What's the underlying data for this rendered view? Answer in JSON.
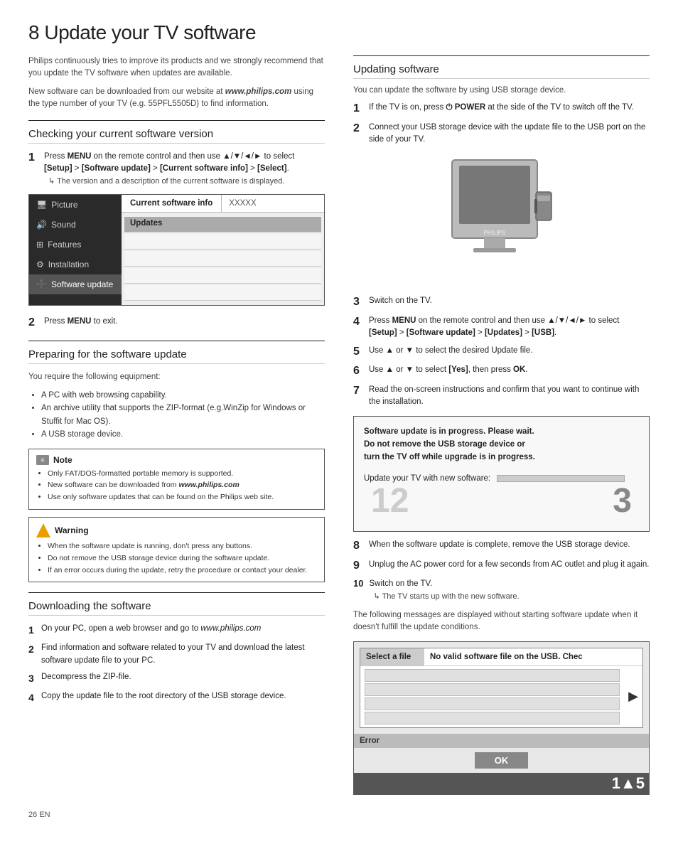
{
  "page": {
    "number": "26",
    "lang": "EN"
  },
  "main_title": "Update your TV software",
  "main_title_num": "8",
  "intro": [
    "Philips continuously tries to improve its products and we strongly recommend that you update the TV software when updates are available.",
    "New software can be downloaded from our website at www.philips.com using the type number of your TV (e.g. 55PFL5505D) to find information."
  ],
  "section_check": {
    "title": "Checking your current software version",
    "steps": [
      {
        "num": "1",
        "text": "Press MENU on the remote control and then use ▲/▼/◄/► to select [Setup] > [Software update] > [Current software info] > [Select].",
        "note": "The version and a description of the current software is displayed."
      },
      {
        "num": "2",
        "text": "Press MENU to exit."
      }
    ],
    "menu": {
      "items": [
        {
          "label": "Picture",
          "icon": "tv"
        },
        {
          "label": "Sound",
          "icon": "speaker"
        },
        {
          "label": "Features",
          "icon": "grid"
        },
        {
          "label": "Installation",
          "icon": "gear"
        },
        {
          "label": "Software update",
          "icon": "plus",
          "active": true
        }
      ],
      "tabs": [
        {
          "label": "Current software info",
          "selected": true
        },
        {
          "label": "XXXXX"
        }
      ],
      "rows": [
        {
          "label": "Updates",
          "highlight": true
        },
        {
          "label": ""
        },
        {
          "label": ""
        },
        {
          "label": ""
        },
        {
          "label": ""
        }
      ]
    }
  },
  "section_prepare": {
    "title": "Preparing for the software update",
    "intro": "You require the following equipment:",
    "items": [
      "A PC with web browsing capability.",
      "An archive utility that supports the ZIP-format (e.g.WinZip for Windows or Stuffit for Mac OS).",
      "A USB storage device."
    ],
    "note": {
      "header": "Note",
      "items": [
        "Only FAT/DOS-formatted portable memory is supported.",
        "New software can be downloaded from www.philips.com",
        "Use only software updates that can be found on the Philips web site."
      ]
    },
    "warning": {
      "header": "Warning",
      "items": [
        "When the software update is running, don't press any buttons.",
        "Do not remove the USB storage device during the software update.",
        "If an error occurs during the update, retry the procedure or contact your dealer."
      ]
    }
  },
  "section_download": {
    "title": "Downloading the software",
    "steps": [
      {
        "num": "1",
        "text": "On your PC, open a web browser and go to www.philips.com"
      },
      {
        "num": "2",
        "text": "Find information and software related to your TV and download the latest software update file to your PC."
      },
      {
        "num": "3",
        "text": "Decompress the ZIP-file."
      },
      {
        "num": "4",
        "text": "Copy the update file to the root directory of the USB storage device."
      }
    ]
  },
  "section_updating": {
    "title": "Updating software",
    "intro": "You can update the software by using USB storage device.",
    "steps": [
      {
        "num": "1",
        "text": "If the TV is on, press ⏻ POWER at the side of the TV to switch off the TV."
      },
      {
        "num": "2",
        "text": "Connect your USB storage device with the update file to the USB port on the side of your TV."
      },
      {
        "num": "3",
        "text": "Switch on the TV."
      },
      {
        "num": "4",
        "text": "Press MENU on the remote control and then use ▲/▼/◄/► to select [Setup] > [Software update] > [Updates] > [USB]."
      },
      {
        "num": "5",
        "text": "Use ▲ or ▼ to select the desired Update file."
      },
      {
        "num": "6",
        "text": "Use ▲ or ▼ to select [Yes], then press OK."
      },
      {
        "num": "7",
        "text": "Read the on-screen instructions and confirm that you want to continue with the installation."
      }
    ],
    "progress_box": {
      "text": "Software update is in progress. Please wait.\nDo not remove the USB storage device or\nturn the TV off while upgrade is in progress.",
      "bar_label": "Update your TV with new software:",
      "num_left": "12",
      "num_right": "3"
    },
    "steps_cont": [
      {
        "num": "8",
        "text": "When the software update is complete, remove the USB storage device."
      },
      {
        "num": "9",
        "text": "Unplug the AC power cord for a few seconds from AC outlet and plug it again."
      },
      {
        "num": "10",
        "text": "Switch on the TV.",
        "note": "The TV starts up with the new software."
      }
    ],
    "following_note": "The following messages are displayed without starting software update when it doesn't fulfill the update conditions.",
    "error_dialog": {
      "label": "Select  a file",
      "message": "No valid software file on the USB. Chec",
      "footer_label": "Error",
      "ok_label": "OK",
      "bottom_num": "1▲5"
    }
  }
}
